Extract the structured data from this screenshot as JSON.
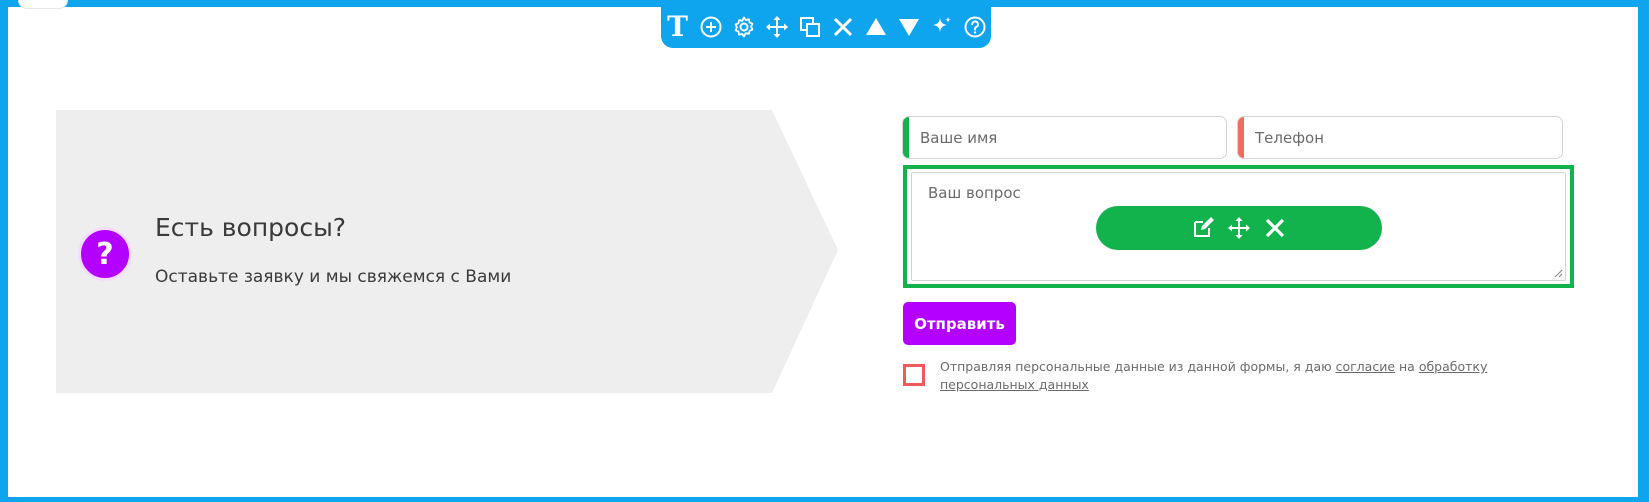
{
  "toolbar": {
    "items": [
      {
        "name": "text-icon",
        "label": "T"
      },
      {
        "name": "add-icon"
      },
      {
        "name": "gear-icon"
      },
      {
        "name": "move-icon"
      },
      {
        "name": "duplicate-icon"
      },
      {
        "name": "close-icon"
      },
      {
        "name": "arrow-up-icon"
      },
      {
        "name": "arrow-down-icon"
      },
      {
        "name": "sparkle-icon"
      },
      {
        "name": "help-icon"
      }
    ]
  },
  "info": {
    "badge": "?",
    "heading": "Есть вопросы?",
    "subtext": "Оставьте заявку и мы свяжемся с Вами"
  },
  "form": {
    "name_placeholder": "Ваше имя",
    "phone_placeholder": "Телефон",
    "question_placeholder": "Ваш вопрос",
    "submit_label": "Отправить",
    "consent_prefix": "Отправляя персональные данные из данной формы, я даю ",
    "consent_link1": "согласие",
    "consent_middle": " на ",
    "consent_link2": "обработку персональных данных"
  },
  "colors": {
    "frame": "#0ea5ee",
    "accent_green": "#12b24c",
    "accent_red": "#f26b5b",
    "submit": "#b300ff",
    "badge": "#b300ff",
    "panel": "#eeeeee"
  }
}
